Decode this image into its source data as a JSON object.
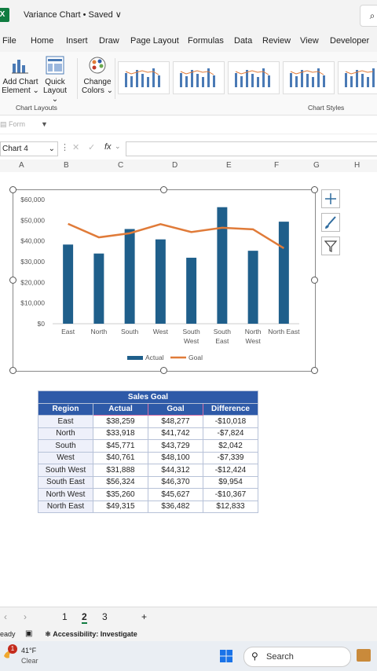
{
  "window": {
    "title": "Variance Chart • Saved",
    "title_chevron": "∨",
    "app_icon_letter": "X"
  },
  "menu": [
    "File",
    "Home",
    "Insert",
    "Draw",
    "Page Layout",
    "Formulas",
    "Data",
    "Review",
    "View",
    "Developer"
  ],
  "ribbon": {
    "add_chart_element": [
      "Add Chart",
      "Element"
    ],
    "quick_layout": [
      "Quick",
      "Layout"
    ],
    "change_colors": [
      "Change",
      "Colors"
    ],
    "group_chart_layouts": "Chart Layouts",
    "group_chart_styles": "Chart Styles"
  },
  "qat": {
    "form_label": "Form"
  },
  "formula_bar": {
    "name_box": "Chart 4",
    "fx": "fx"
  },
  "columns": [
    "A",
    "B",
    "C",
    "D",
    "E",
    "F",
    "G",
    "H"
  ],
  "chart_data": {
    "type": "bar",
    "categories": [
      "East",
      "North",
      "South",
      "West",
      "South West",
      "South East",
      "North West",
      "North East"
    ],
    "category_lines": [
      [
        "East"
      ],
      [
        "North"
      ],
      [
        "South"
      ],
      [
        "West"
      ],
      [
        "South",
        "West"
      ],
      [
        "South",
        "East"
      ],
      [
        "North",
        "West"
      ],
      [
        "North East"
      ]
    ],
    "series": [
      {
        "name": "Actual",
        "type": "bar",
        "color": "#1f5f8b",
        "values": [
          38259,
          33918,
          45771,
          40761,
          31888,
          56324,
          35260,
          49315
        ]
      },
      {
        "name": "Goal",
        "type": "line",
        "color": "#e07b39",
        "values": [
          48277,
          41742,
          43729,
          48100,
          44312,
          46370,
          45627,
          36482
        ]
      }
    ],
    "y_ticks": [
      "$0",
      "$10,000",
      "$20,000",
      "$30,000",
      "$40,000",
      "$50,000",
      "$60,000"
    ],
    "ylim": [
      0,
      60000
    ],
    "legend": "bottom"
  },
  "table": {
    "title": "Sales Goal",
    "headers": [
      "Region",
      "Actual",
      "Goal",
      "Difference"
    ],
    "rows": [
      [
        "East",
        "$38,259",
        "$48,277",
        "-$10,018"
      ],
      [
        "North",
        "$33,918",
        "$41,742",
        "-$7,824"
      ],
      [
        "South",
        "$45,771",
        "$43,729",
        "$2,042"
      ],
      [
        "West",
        "$40,761",
        "$48,100",
        "-$7,339"
      ],
      [
        "South West",
        "$31,888",
        "$44,312",
        "-$12,424"
      ],
      [
        "South East",
        "$56,324",
        "$46,370",
        "$9,954"
      ],
      [
        "North West",
        "$35,260",
        "$45,627",
        "-$10,367"
      ],
      [
        "North East",
        "$49,315",
        "$36,482",
        "$12,833"
      ]
    ]
  },
  "sheet_tabs": {
    "tabs": [
      "1",
      "2",
      "3"
    ],
    "active": "2",
    "add": "+"
  },
  "status": {
    "ready": "eady",
    "accessibility": "Accessibility: Investigate"
  },
  "taskbar": {
    "temp": "41°F",
    "condition": "Clear",
    "badge": "1",
    "search": "Search"
  }
}
